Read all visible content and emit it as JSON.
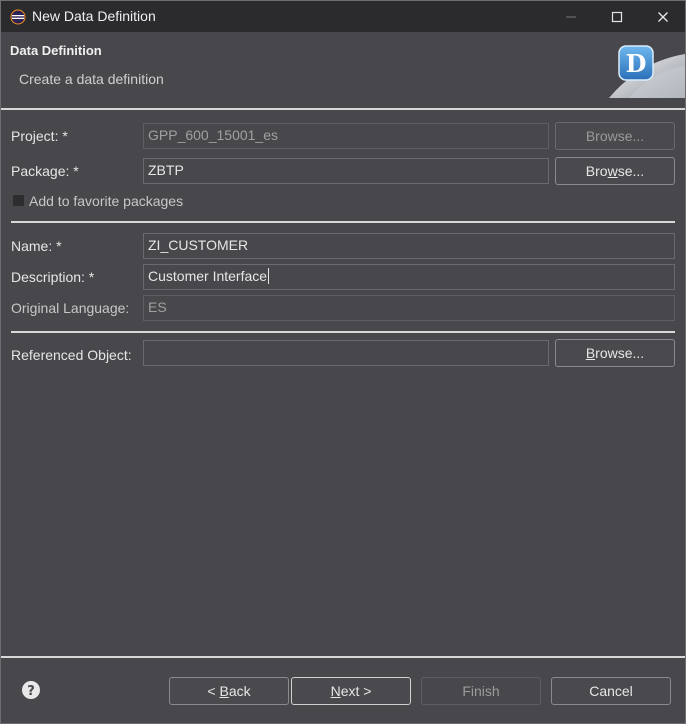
{
  "window": {
    "title": "New Data Definition",
    "minimize_icon": "minimize-icon",
    "maximize_icon": "maximize-icon",
    "close_icon": "close-icon"
  },
  "header": {
    "title": "Data Definition",
    "subtitle": "Create a data definition",
    "banner_letter": "D"
  },
  "form": {
    "project": {
      "label": "Project: *",
      "value": "GPP_600_15001_es",
      "browse": "Browse..."
    },
    "package": {
      "label": "Package: *",
      "value": "ZBTP",
      "browse_pre": "Bro",
      "browse_mn": "w",
      "browse_post": "se..."
    },
    "favorite": {
      "label": "Add to favorite packages",
      "checked": false
    },
    "name": {
      "label": "Name: *",
      "value": "ZI_CUSTOMER"
    },
    "description": {
      "label": "Description: *",
      "value": "Customer Interface"
    },
    "language": {
      "label": "Original Language:",
      "value": "ES"
    },
    "referenced": {
      "label": "Referenced Object:",
      "value": "",
      "browse_pre": "",
      "browse_mn": "B",
      "browse_post": "rowse..."
    }
  },
  "footer": {
    "help_icon": "help-icon",
    "back_pre": "< ",
    "back_mn": "B",
    "back_post": "ack",
    "next_mn": "N",
    "next_post": "ext >",
    "finish": "Finish",
    "cancel": "Cancel"
  },
  "colors": {
    "background": "#48484c",
    "titlebar": "#2b2b2e",
    "separator": "#d8d8d8",
    "banner_blue": "#3a8fd8"
  }
}
